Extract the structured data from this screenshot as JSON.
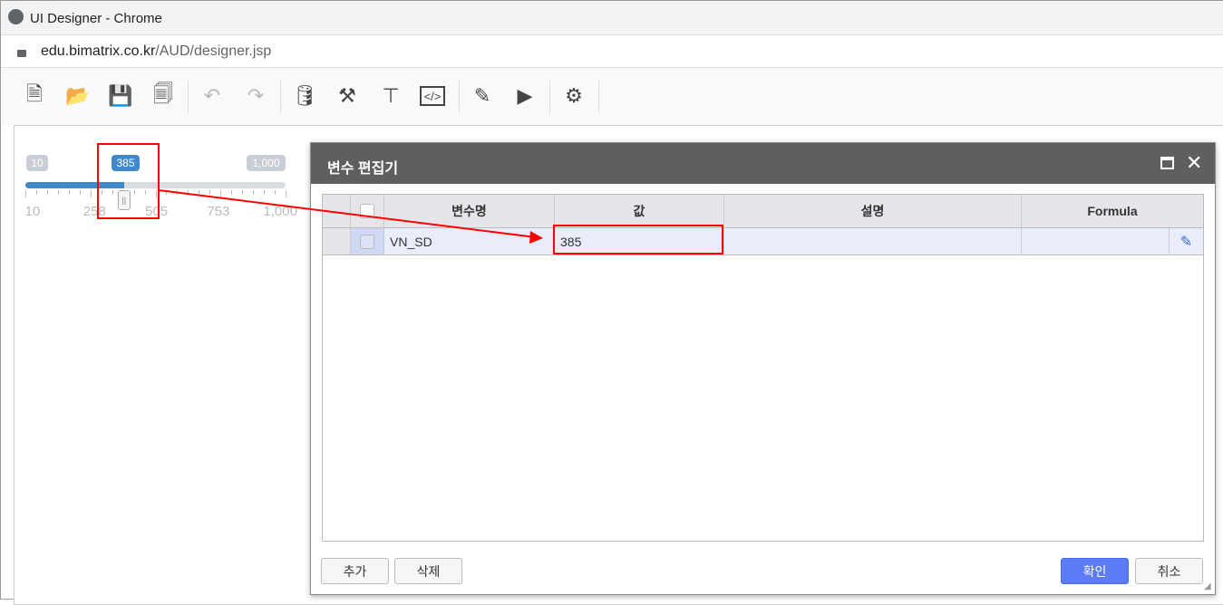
{
  "browser": {
    "title": "UI Designer - Chrome",
    "url_host": "edu.bimatrix.co.kr",
    "url_path": "/AUD/designer.jsp"
  },
  "toolbar": {
    "icons": [
      "new-document-icon",
      "open-folder-icon",
      "save-icon",
      "save-all-icon",
      "undo-icon",
      "redo-icon",
      "database-icon",
      "tools-icon",
      "hierarchy-icon",
      "code-icon",
      "edit-icon",
      "run-icon",
      "settings-icon"
    ]
  },
  "slider": {
    "min_label": "10",
    "max_label": "1,000",
    "value_label": "385",
    "value": 385,
    "min": 10,
    "max": 1000,
    "scale": [
      "10",
      "258",
      "505",
      "753",
      "1,000"
    ]
  },
  "dialog": {
    "title": "변수 편집기",
    "columns": [
      "변수명",
      "값",
      "설명",
      "Formula"
    ],
    "rows": [
      {
        "name": "VN_SD",
        "value": "385",
        "description": "",
        "formula": ""
      }
    ],
    "buttons": {
      "add": "추가",
      "delete": "삭제",
      "ok": "확인",
      "cancel": "취소"
    }
  },
  "colors": {
    "accent": "#5b7cf5",
    "slider_fill": "#3f88c9",
    "highlight": "#ff0000",
    "dialog_header": "#5f5f61"
  }
}
